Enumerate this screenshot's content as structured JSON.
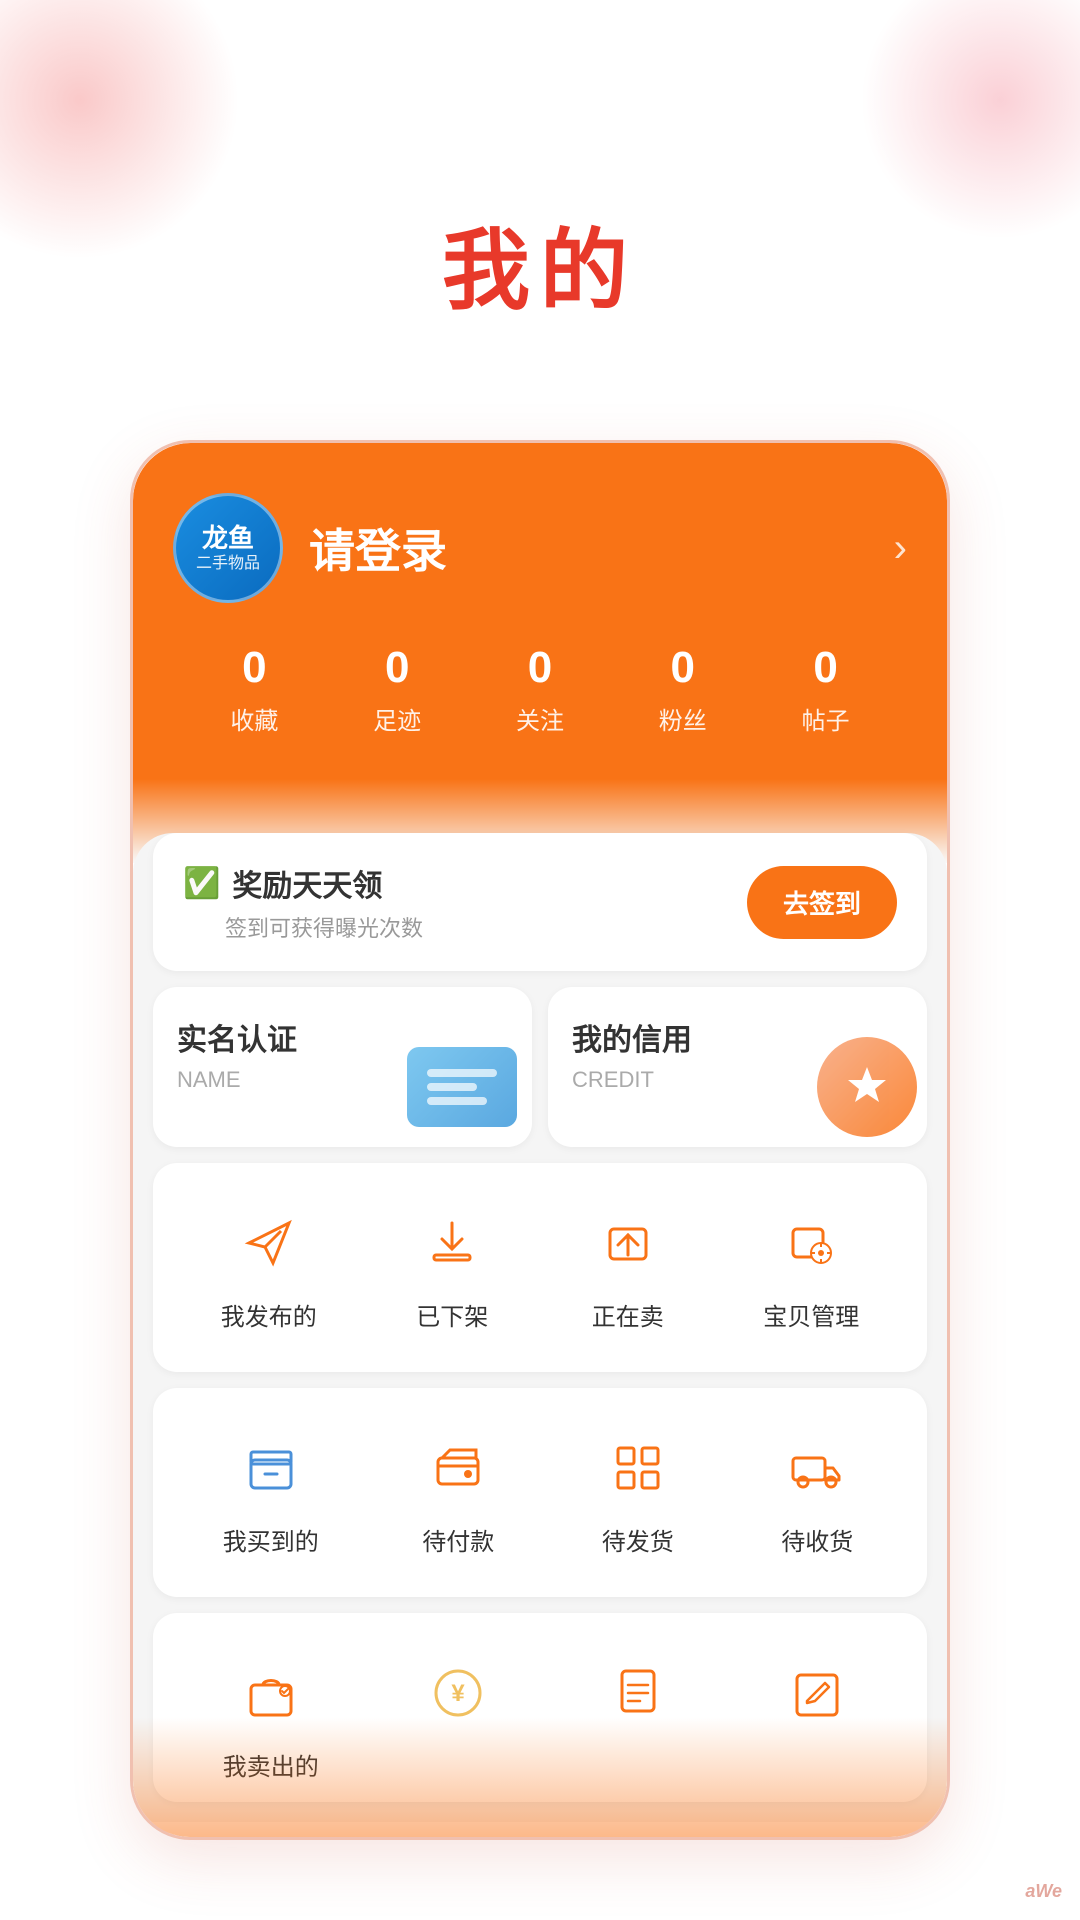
{
  "page": {
    "title": "我的",
    "background_color": "#ffffff"
  },
  "header": {
    "logo_main": "龙鱼",
    "logo_sub": "二手物品",
    "login_text": "请登录",
    "chevron": "›"
  },
  "stats": [
    {
      "value": "0",
      "label": "收藏"
    },
    {
      "value": "0",
      "label": "足迹"
    },
    {
      "value": "0",
      "label": "关注"
    },
    {
      "value": "0",
      "label": "粉丝"
    },
    {
      "value": "0",
      "label": "帖子"
    }
  ],
  "reward_card": {
    "title": "奖励天天领",
    "subtitle": "签到可获得曝光次数",
    "btn_label": "去签到"
  },
  "verify_cards": [
    {
      "title": "实名认证",
      "subtitle": "NAME"
    },
    {
      "title": "我的信用",
      "subtitle": "CREDIT"
    }
  ],
  "sell_actions": [
    {
      "label": "我发布的",
      "icon": "send"
    },
    {
      "label": "已下架",
      "icon": "download"
    },
    {
      "label": "正在卖",
      "icon": "upload"
    },
    {
      "label": "宝贝管理",
      "icon": "settings"
    }
  ],
  "buy_actions": [
    {
      "label": "我买到的",
      "icon": "box"
    },
    {
      "label": "待付款",
      "icon": "wallet"
    },
    {
      "label": "待发货",
      "icon": "grid"
    },
    {
      "label": "待收货",
      "icon": "truck"
    }
  ],
  "bottom_actions": [
    {
      "label": "我卖出的",
      "icon": "bag"
    },
    {
      "label": "",
      "icon": "yen"
    },
    {
      "label": "",
      "icon": "doc"
    },
    {
      "label": "",
      "icon": "edit"
    }
  ],
  "watermark": "aWe"
}
